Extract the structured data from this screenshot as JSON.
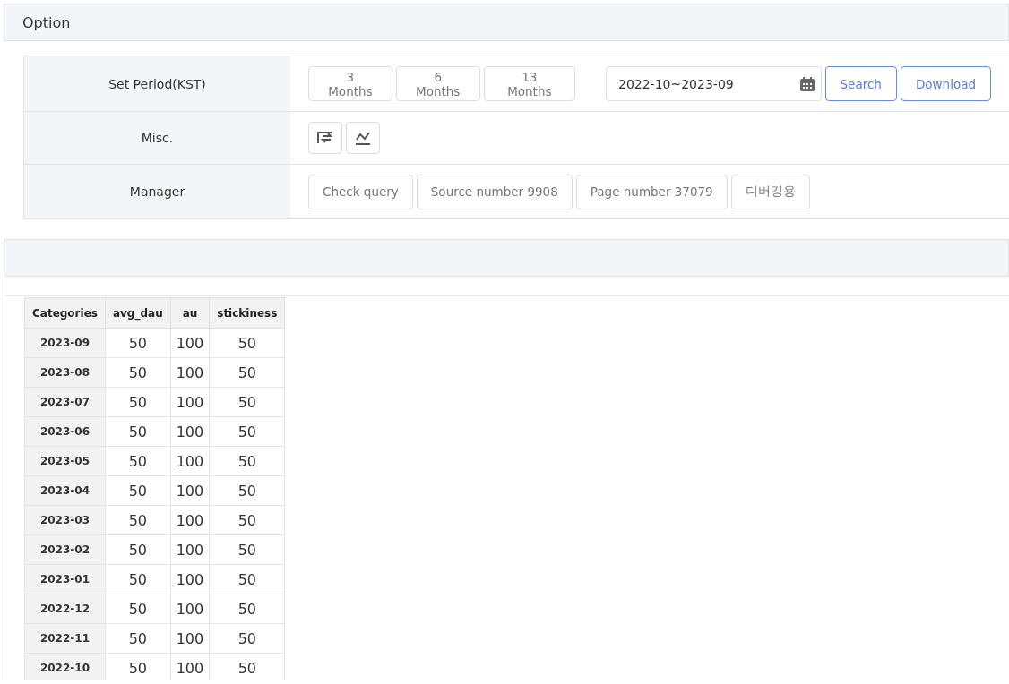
{
  "option_panel": {
    "title": "Option",
    "rows": [
      {
        "kind": "period",
        "label": "Set Period(KST)",
        "presets": [
          "3 Months",
          "6 Months",
          "13 Months"
        ],
        "date_range": "2022-10~2023-09",
        "actions": [
          "Search",
          "Download"
        ]
      },
      {
        "kind": "icons",
        "label": "Misc."
      },
      {
        "kind": "buttons",
        "label": "Manager",
        "buttons": [
          "Check query",
          "Source number 9908",
          "Page number 37079",
          "디버깅용"
        ]
      }
    ]
  },
  "table": {
    "columns": [
      "Categories",
      "avg_dau",
      "au",
      "stickiness"
    ],
    "rows": [
      [
        "2023-09",
        "50",
        "100",
        "50"
      ],
      [
        "2023-08",
        "50",
        "100",
        "50"
      ],
      [
        "2023-07",
        "50",
        "100",
        "50"
      ],
      [
        "2023-06",
        "50",
        "100",
        "50"
      ],
      [
        "2023-05",
        "50",
        "100",
        "50"
      ],
      [
        "2023-04",
        "50",
        "100",
        "50"
      ],
      [
        "2023-03",
        "50",
        "100",
        "50"
      ],
      [
        "2023-02",
        "50",
        "100",
        "50"
      ],
      [
        "2023-01",
        "50",
        "100",
        "50"
      ],
      [
        "2022-12",
        "50",
        "100",
        "50"
      ],
      [
        "2022-11",
        "50",
        "100",
        "50"
      ],
      [
        "2022-10",
        "50",
        "100",
        "50"
      ]
    ]
  }
}
